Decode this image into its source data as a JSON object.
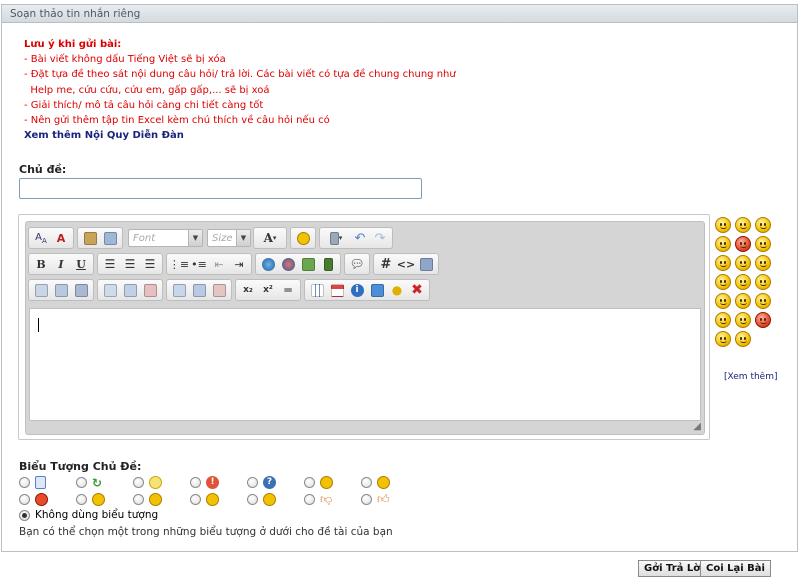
{
  "panel": {
    "title": "Soạn thảo tin nhắn riêng"
  },
  "notes": {
    "title": "Lưu ý khi gửi bài:",
    "lines": [
      "- Bài viết không dấu Tiếng Việt sẽ bị xóa",
      "- Đặt tựa đề theo sát nội dung câu hỏi/ trả lời. Các bài viết có tựa đề chung chung như",
      "  Help me, cứu cứu, cứu em, gấp gấp,... sẽ bị xoá",
      "- Giải thích/ mô tả câu hỏi càng chi tiết càng tốt",
      "- Nên gửi thêm tập tin Excel kèm chú thích về câu hỏi nếu có"
    ],
    "more_link": "Xem thêm Nội Quy Diễn Đàn"
  },
  "subject": {
    "label": "Chủ đề:",
    "value": ""
  },
  "editor": {
    "font_placeholder": "Font",
    "size_placeholder": "Size",
    "bold": "B",
    "italic": "I",
    "underline": "U",
    "hash": "#",
    "code": "<>",
    "text_color": "A",
    "subscript": "x₂",
    "superscript": "x²"
  },
  "smilies": {
    "see_more": "[Xem thêm]"
  },
  "post_icons": {
    "label": "Biểu Tượng Chủ Đề:",
    "none_label": "Không dùng biểu tượng",
    "hint": "Bạn có thể chọn một trong những biểu tượng ở dưới cho đề tài của bạn"
  },
  "buttons": {
    "submit": "Gởi Trả Lời",
    "preview": "Coi Lại Bài"
  }
}
